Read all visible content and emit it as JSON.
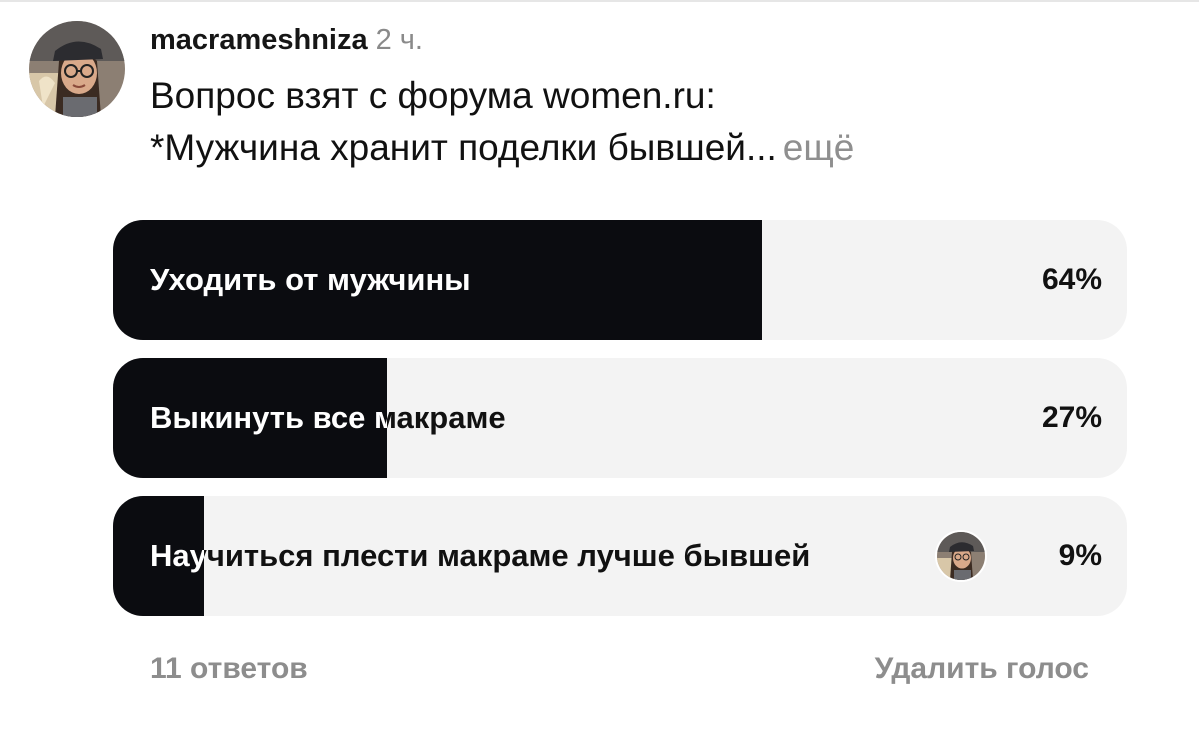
{
  "post": {
    "username": "macrameshniza",
    "timestamp": "2 ч.",
    "text_line1": "Вопрос взят с форума women.ru:",
    "text_line2": "*Мужчина хранит поделки бывшей...",
    "more_label": "ещё"
  },
  "poll": {
    "options": [
      {
        "label": "Уходить от мужчины",
        "percent_label": "64%",
        "fill_fraction": 0.64,
        "has_voter_avatar": false
      },
      {
        "label": "Выкинуть все макраме",
        "percent_label": "27%",
        "fill_fraction": 0.27,
        "has_voter_avatar": false
      },
      {
        "label": "Научиться плести макраме лучше бывшей",
        "percent_label": "9%",
        "fill_fraction": 0.09,
        "has_voter_avatar": true
      }
    ],
    "fill_color": "#0b0c10",
    "track_color": "#f3f3f3"
  },
  "footer": {
    "responses_label": "11 ответов",
    "remove_vote_label": "Удалить голос"
  },
  "icons": {
    "avatar": "user-avatar-photo",
    "voter_avatar": "voter-avatar-photo"
  }
}
